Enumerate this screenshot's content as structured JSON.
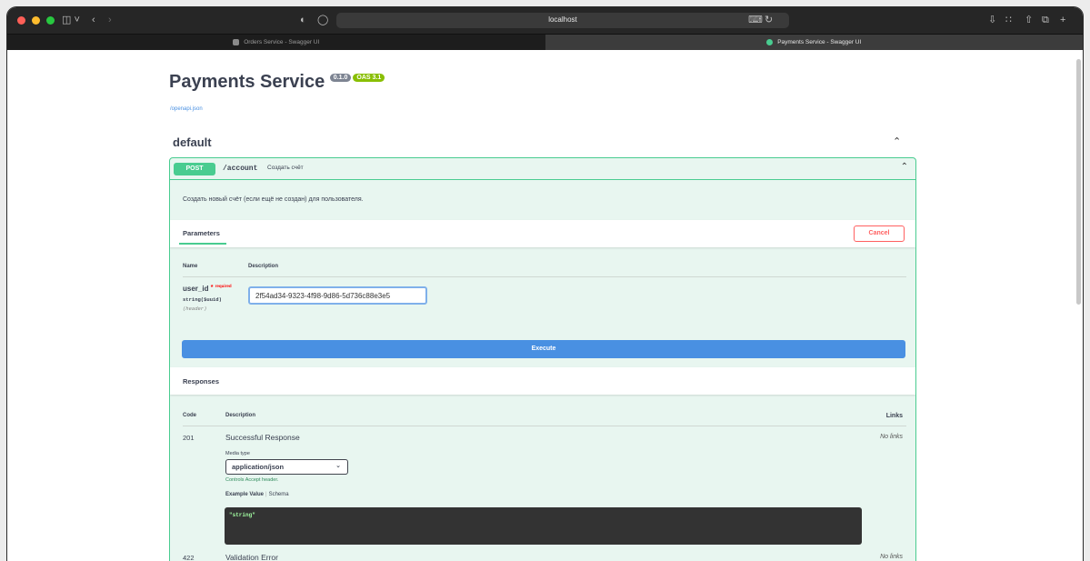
{
  "browser": {
    "address": "localhost",
    "tabs": [
      {
        "title": "Orders Service - Swagger UI",
        "active": false
      },
      {
        "title": "Payments Service - Swagger UI",
        "active": true
      }
    ]
  },
  "header": {
    "title": "Payments Service",
    "version_badge": "0.1.0",
    "oas_badge": "OAS 3.1",
    "spec_link": "/openapi.json"
  },
  "section": {
    "title": "default"
  },
  "operation": {
    "method": "POST",
    "path": "/account",
    "summary": "Создать счёт",
    "description": "Создать новый счёт (если ещё не создан) для пользователя.",
    "params_tab": "Parameters",
    "cancel_label": "Cancel",
    "col_name": "Name",
    "col_description": "Description",
    "param": {
      "name": "user_id",
      "required_star": "*",
      "required_label": "required",
      "type": "string($uuid)",
      "in": "(header)",
      "value": "2f54ad34-9323-4f98-9d86-5d736c88e3e5"
    },
    "execute_label": "Execute"
  },
  "responses": {
    "title": "Responses",
    "col_code": "Code",
    "col_description": "Description",
    "col_links": "Links",
    "items": [
      {
        "code": "201",
        "description": "Successful Response",
        "links": "No links"
      },
      {
        "code": "422",
        "description": "Validation Error",
        "links": "No links"
      }
    ],
    "media_type_label": "Media type",
    "media_type_value": "application/json",
    "accept_note": "Controls Accept header.",
    "example_value_tab": "Example Value",
    "schema_tab": "Schema",
    "example_code": "\"string\""
  },
  "colors": {
    "post": "#49cc90",
    "execute": "#4990e2",
    "cancel": "#ff6060"
  }
}
